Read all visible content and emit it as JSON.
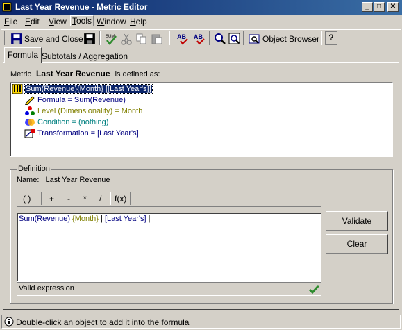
{
  "window": {
    "title": "Last Year Revenue - Metric Editor",
    "minimize": "_",
    "maximize": "□",
    "close": "✕"
  },
  "menu": [
    "File",
    "Edit",
    "View",
    "Tools",
    "Window",
    "Help"
  ],
  "menu_mnemonics": [
    "F",
    "E",
    "V",
    "T",
    "W",
    "H"
  ],
  "toolbar": {
    "save_and_close": "Save and Close",
    "object_browser": "Object Browser",
    "help": "?"
  },
  "tabs": [
    "Formula",
    "Subtotals / Aggregation"
  ],
  "metric": {
    "prefix": "Metric",
    "name": "Last Year Revenue",
    "suffix": "is defined as:"
  },
  "tree": {
    "root": "Sum(Revenue){Month} [[Last Year's]]",
    "children": [
      {
        "label": "Formula = Sum(Revenue)",
        "color": "#000080",
        "icon": "formula-icon"
      },
      {
        "label": "Level (Dimensionality) = Month",
        "color": "#808000",
        "icon": "level-icon"
      },
      {
        "label": "Condition = (nothing)",
        "color": "#008080",
        "icon": "condition-icon"
      },
      {
        "label": "Transformation = [Last Year's]",
        "color": "#000080",
        "icon": "transformation-icon"
      }
    ]
  },
  "definition": {
    "legend": "Definition",
    "name_label": "Name:",
    "name_value": "Last Year Revenue",
    "operators": [
      "( )",
      "+",
      "-",
      "*",
      "/",
      "f(x)"
    ],
    "expression_parts": [
      "Sum(Revenue) ",
      "{Month}",
      " | ",
      "[Last Year's]",
      " |"
    ],
    "status": "Valid expression",
    "validate": "Validate",
    "clear": "Clear"
  },
  "statusbar": {
    "text": "Double-click an object to add it into the formula"
  },
  "colors": {
    "title_start": "#0a246a",
    "title_end": "#3a6ea5",
    "level": "#808000",
    "condition": "#008080",
    "formula": "#000080",
    "valid_check": "#2e8b2e"
  }
}
